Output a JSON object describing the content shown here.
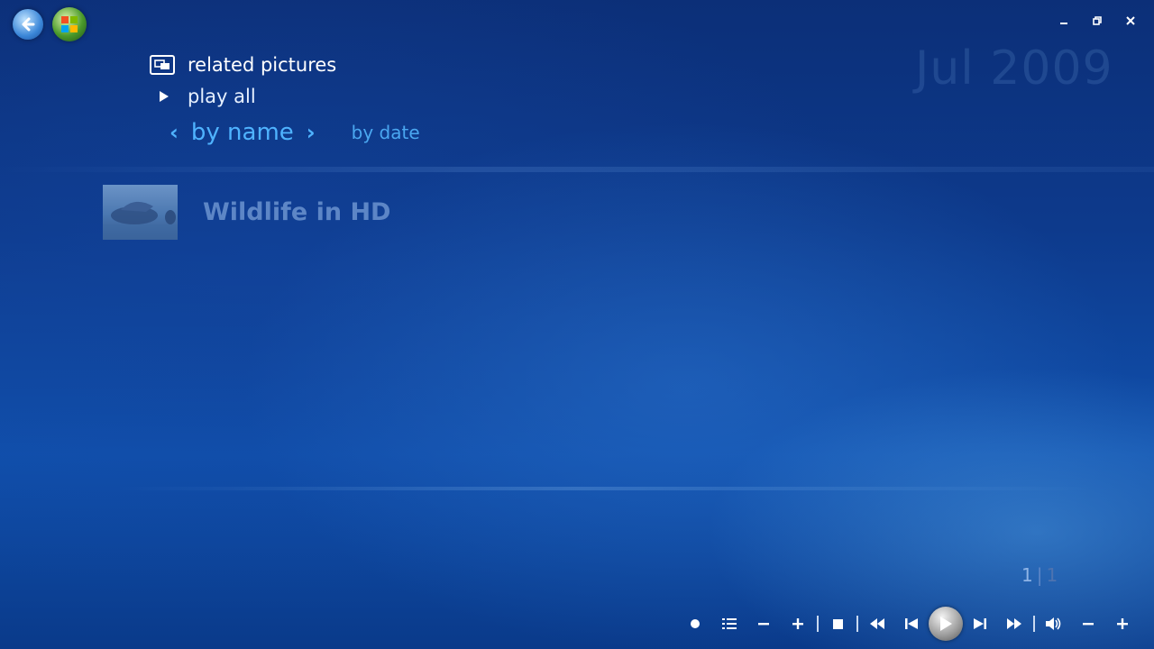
{
  "nav": {
    "back_icon": "back-arrow-icon",
    "start_icon": "windows-logo-icon"
  },
  "window_controls": [
    "minimize-icon",
    "restore-icon",
    "close-icon"
  ],
  "header": {
    "date": "Jul 2009"
  },
  "menu": {
    "related_label": "related pictures",
    "play_all_label": "play all"
  },
  "sort": {
    "selected": "by name",
    "alternate": "by date"
  },
  "items": [
    {
      "title": "Wildlife in HD"
    }
  ],
  "pager": {
    "current": "1",
    "total": "1"
  },
  "transport": [
    "record-icon",
    "guide-icon",
    "channel-down-icon",
    "channel-up-icon",
    "stop-icon",
    "rewind-icon",
    "previous-icon",
    "play-icon",
    "next-icon",
    "fast-forward-icon",
    "mute-icon",
    "volume-down-icon",
    "volume-up-icon"
  ],
  "colors": {
    "accent": "#4fb3ff",
    "background": "#0d3a8c",
    "dim_text": "#5d86c6"
  }
}
